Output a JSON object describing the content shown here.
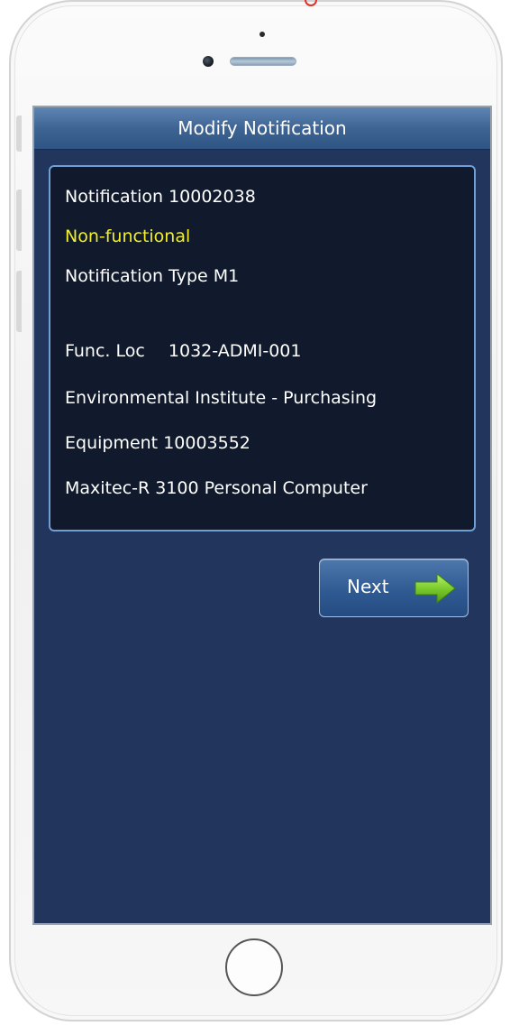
{
  "app": {
    "title": "Modify Notification"
  },
  "notification": {
    "label": "Notification",
    "number": "10002038",
    "status": "Non-functional",
    "type_label": "Notification Type",
    "type_value": "M1",
    "func_loc_label": "Func. Loc",
    "func_loc_value": "1032-ADMI-001",
    "func_loc_description": "Environmental Institute - Purchasing",
    "equipment_label": "Equipment",
    "equipment_value": "10003552",
    "equipment_description": "Maxitec-R 3100 Personal Computer"
  },
  "actions": {
    "next_label": "Next",
    "next_icon": "arrow-right-icon"
  },
  "colors": {
    "screen_background": "#22355c",
    "title_bar": "#3e6494",
    "panel_background": "#101a2c",
    "panel_border": "#6f9fd6",
    "status_text": "#f2ef2a",
    "arrow": "#7ccc2e"
  }
}
